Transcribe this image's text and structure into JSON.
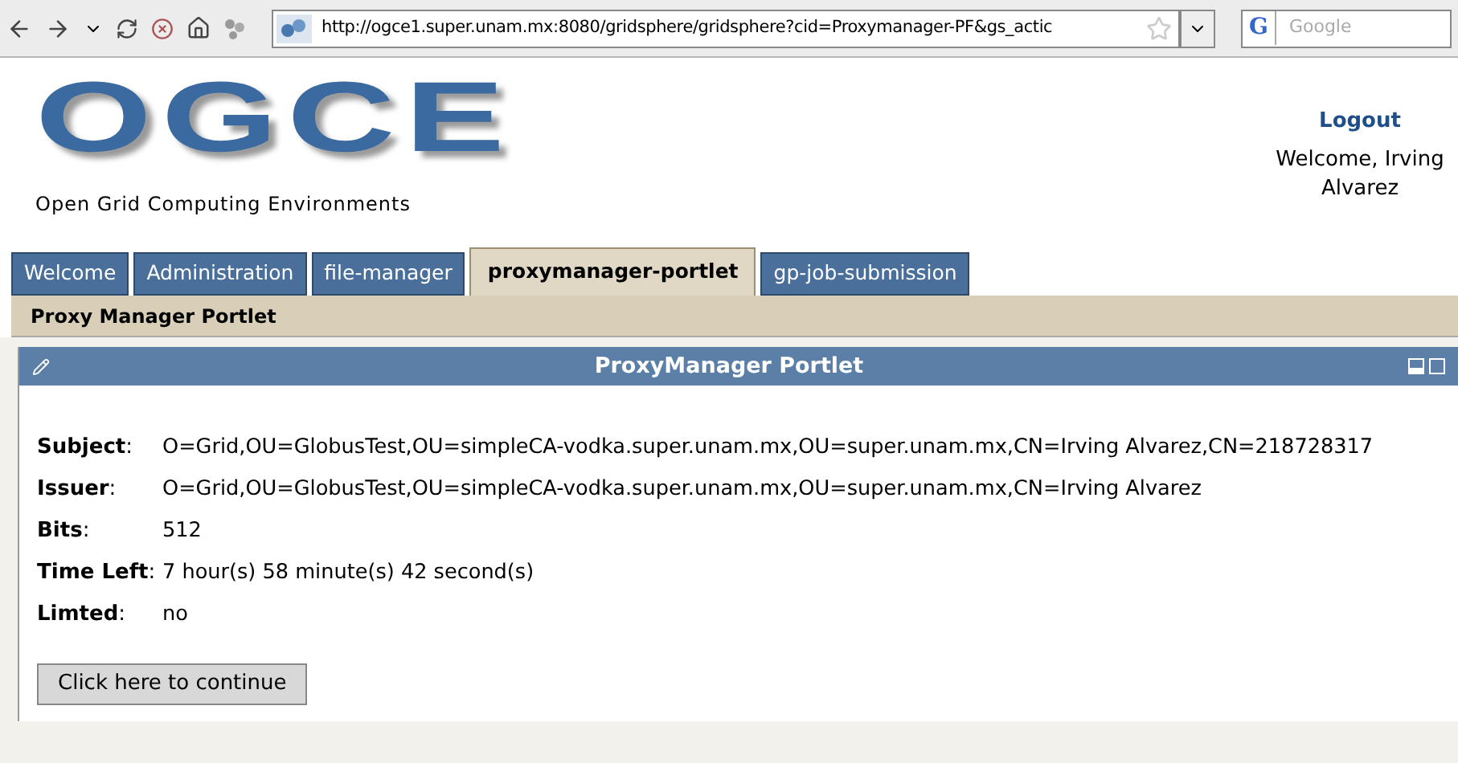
{
  "browser": {
    "url": "http://ogce1.super.unam.mx:8080/gridsphere/gridsphere?cid=Proxymanager-PF&gs_actic",
    "search_engine": "G",
    "search_placeholder": "Google"
  },
  "header": {
    "logo": "OGCE",
    "tagline": "Open Grid Computing Environments",
    "logout": "Logout",
    "welcome": "Welcome, Irving Alvarez"
  },
  "tabs": [
    {
      "label": "Welcome",
      "selected": false
    },
    {
      "label": "Administration",
      "selected": false
    },
    {
      "label": "file-manager",
      "selected": false
    },
    {
      "label": "proxymanager-portlet",
      "selected": true
    },
    {
      "label": "gp-job-submission",
      "selected": false
    }
  ],
  "breadcrumb": "Proxy Manager Portlet",
  "portlet": {
    "title": "ProxyManager Portlet",
    "fields": [
      {
        "label": "**Subject**:",
        "value": "O=Grid,OU=GlobusTest,OU=simpleCA-vodka.super.unam.mx,OU=super.unam.mx,CN=Irving Alvarez,CN=218728317"
      },
      {
        "label": "**Issuer**:",
        "value": "O=Grid,OU=GlobusTest,OU=simpleCA-vodka.super.unam.mx,OU=super.unam.mx,CN=Irving Alvarez"
      },
      {
        "label": "**Bits**:",
        "value": "512"
      },
      {
        "label": "**Time Left**:",
        "value": "7 hour(s) 58 minute(s) 42 second(s)"
      },
      {
        "label": "**Limted**:",
        "value": "no"
      }
    ],
    "button": "Click here to continue"
  }
}
